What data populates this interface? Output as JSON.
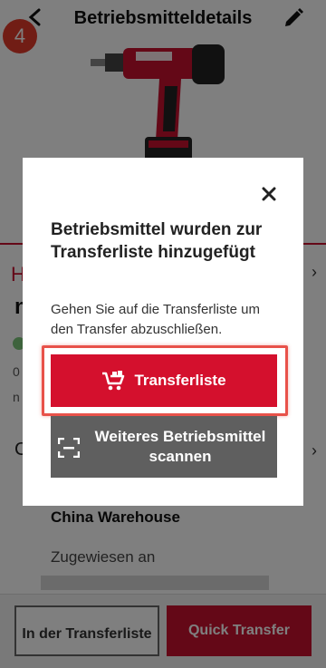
{
  "step_badge": "4",
  "header": {
    "title": "Betriebsmitteldetails",
    "back_icon": "back-arrow-icon",
    "edit_icon": "pencil-icon"
  },
  "background": {
    "section_letter_h": "H",
    "section_letter_n": "n",
    "value_zero": "0",
    "value_n": "n",
    "section_letter_c": "C",
    "location_name": "China Warehouse",
    "assigned_label": "Zugewiesen an"
  },
  "dialog": {
    "title": "Betriebsmittel wurden zur Transferliste hinzugefügt",
    "body": "Gehen Sie auf die Transferliste um den Transfer abzuschließen.",
    "primary_button": "Transferliste",
    "secondary_button": "Weiteres Betriebsmittel scannen",
    "close_icon": "close-icon",
    "primary_icon": "cart-icon",
    "secondary_icon": "scan-icon"
  },
  "bottom_bar": {
    "left_button": "In der Transferliste",
    "right_button": "Quick Transfer"
  },
  "colors": {
    "brand_red": "#d4102d",
    "dark_gray": "#5f5f5f",
    "badge_red": "#e33a2a",
    "highlight": "#e8524a"
  }
}
